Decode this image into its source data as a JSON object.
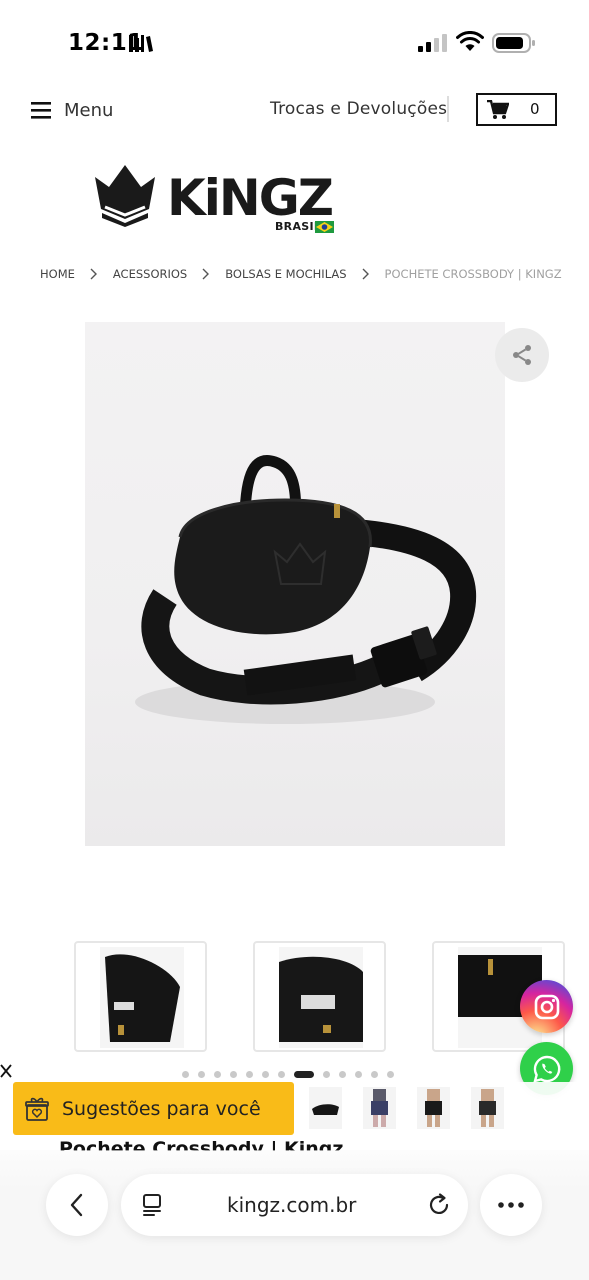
{
  "status_bar": {
    "time": "12:11"
  },
  "header": {
    "menu_label": "Menu",
    "exchange_link": "Trocas e Devoluções",
    "cart_count": "0"
  },
  "logo": {
    "brand": "KiNGZ",
    "sub": "BRASIL"
  },
  "breadcrumb": {
    "items": [
      "HOME",
      "ACESSORIOS",
      "BOLSAS E MOCHILAS",
      "POCHETE CROSSBODY | KINGZ"
    ]
  },
  "gallery": {
    "dot_count": 13,
    "active_dot": 7
  },
  "suggestions": {
    "label": "Sugestões para você"
  },
  "product": {
    "title": "Pochete Crossbody | Kingz"
  },
  "browser": {
    "url": "kingz.com.br"
  },
  "colors": {
    "accent_yellow": "#f9bb18",
    "whatsapp_green": "#2fd04a",
    "text_dark": "#222222"
  },
  "icons": [
    "signal-icon",
    "wifi-icon",
    "battery-icon",
    "hamburger-icon",
    "cart-icon",
    "share-icon",
    "instagram-icon",
    "whatsapp-icon",
    "close-icon",
    "gift-icon",
    "back-icon",
    "tabs-icon",
    "reload-icon",
    "more-icon"
  ]
}
